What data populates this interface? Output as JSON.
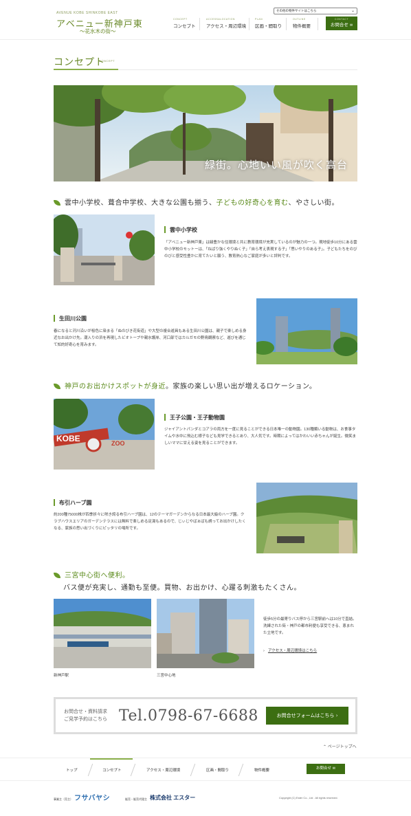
{
  "header": {
    "logo_sub": "AVENUE KOBE SHINKOBE EAST",
    "logo_main": "アベニュー新神戸東",
    "logo_tag": "～花水木の街～",
    "site_select": "その他の物件サイトはこちら",
    "nav": [
      {
        "en": "CONCEPT",
        "jp": "コンセプト"
      },
      {
        "en": "ACCESS&LOCATION",
        "jp": "アクセス・周辺環境"
      },
      {
        "en": "PLAN",
        "jp": "区画・間取り"
      },
      {
        "en": "OUTLINE",
        "jp": "物件概要"
      }
    ],
    "contact": {
      "en": "CONTACT",
      "jp": "お問合せ"
    }
  },
  "page": {
    "title": "コンセプト",
    "title_en": "CONCEPT"
  },
  "hero": {
    "caption": "緑街。心地いい風が吹く高台"
  },
  "sections": [
    {
      "heading_pre": "雲中小学校、葺合中学校、大きな公園も揃う、",
      "heading_hl": "子どもの好奇心を育む",
      "heading_post": "、やさしい街。"
    },
    {
      "heading_hl": "神戸のお出かけスポットが身近",
      "heading_post": "。家族の楽しい思い出が増えるロケーション。"
    },
    {
      "heading_hl": "三宮中心街へ便利。",
      "subheading": "バス便が充実し、通勤も至便。買物、お出かけ、心躍る刺激もたくさん。"
    }
  ],
  "blocks": {
    "school": {
      "title": "雲中小学校",
      "text": "「アベニュー新神戸東」は緑豊かな住環境と共に教育環境が充実しているのが魅力の一つ。現地徒歩10分にある雲中小学校のモットーは、「ねばり強くやりぬく子」「自ら考え表現する子」「思いやりのある子」。子どもたちをのびのびと感受性豊かに育てたいと願う、教育熱心なご家庭が多いと評判です。"
    },
    "ikuta": {
      "title": "生田川公園",
      "text": "春になると河川沿いが桜色に染まる「ぬのびき花街道」や大型の複合遊具もある生田川公園は、親子で楽しめる身近なお出かけ先。潮入りの浜を再現したビオトープや親水護岸、河口部ではカルガモの野鳥観察など、遊びを通じて知的好奇心を育みます。"
    },
    "zoo": {
      "title": "王子公園・王子動物園",
      "text": "ジャイアントパンダとコアラの両方を一度に見ることができる日本唯一の動物園。130種類いる動物は、お食事タイムや水中に飛込む様子なども見学できるとあり、大人気です。時期によってはかわいい赤ちゃんが誕生。微笑ましいママに甘える姿を見ることができます。"
    },
    "herb": {
      "title": "布引ハーブ園",
      "text": "約200種75000株が四季折々に咲き誇る布引ハーブ園は、12のテーマガーデンからなる日本最大級のハーブ園。クラブハウスエリアのガーデンテラスには無料で楽しめる足湯もあるので、じぃじやばぁばも誘ってお出かけしたくなる、家族の思い出づくりにピッタリの場所です。"
    },
    "station": {
      "photo1_caption": "新神戸駅",
      "photo2_caption": "三宮中心地",
      "text": "徒歩5分の最寄りバス停から三宮駅前へは10分で直結。洗練された街・神戸の都市利便も享受できる、恵まれた立地です。",
      "link": "アクセス・周辺環境はこちら"
    }
  },
  "contact_box": {
    "label_line1": "お問合せ・資料請求",
    "label_line2": "ご見学予約はこちら",
    "tel": "Tel.0798-67-6688",
    "button": "お問合せフォームはこちら"
  },
  "page_top": "ページトップへ",
  "footer_nav": [
    "トップ",
    "コンセプト",
    "アクセス・周辺環境",
    "区画・間取り",
    "物件概要"
  ],
  "footer_contact": "お問合せ",
  "footer": {
    "label1": "事業主（売主）",
    "logo1": "フサバヤシ",
    "label2": "販売・販売代理主",
    "logo2": "株式会社 エスター",
    "copyright": "Copyright (C) Ester Co., Ltd . All rights reserved."
  },
  "colors": {
    "accent": "#3c6e12",
    "highlight": "#5a8a1a",
    "title": "#6a8a2a"
  }
}
